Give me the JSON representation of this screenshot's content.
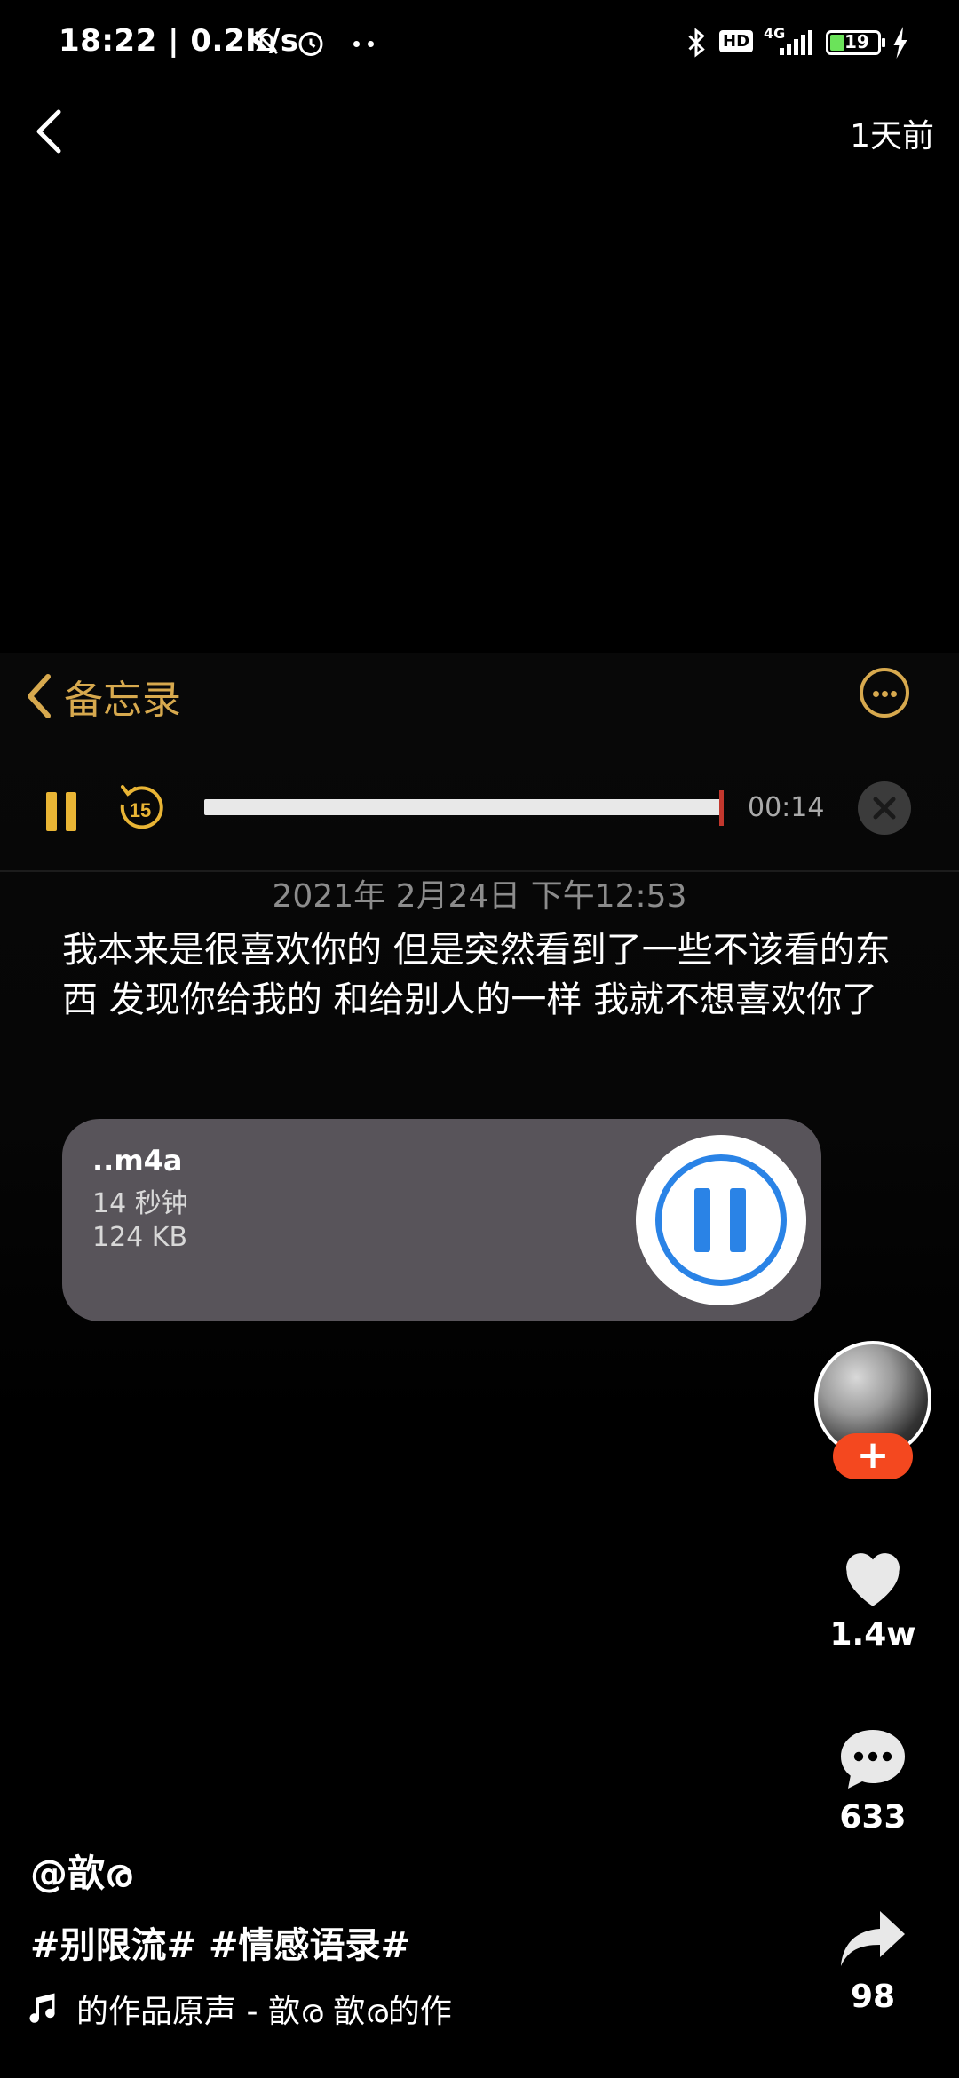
{
  "status_bar": {
    "text": "18:22 | 0.2K/s",
    "network": "4G",
    "hd": "HD",
    "battery": "19"
  },
  "top_bar": {
    "time_ago": "1天前"
  },
  "notes": {
    "back_label": "备忘录",
    "player_time": "00:14",
    "player_progress": 1.0,
    "rewind_seconds": "15",
    "date": "2021年 2月24日 下午12:53",
    "text": "我本来是很喜欢你的 但是突然看到了一些不该看的东西 发现你给我的 和给别人的一样 我就不想喜欢你了",
    "attachment": {
      "name": "..m4a",
      "duration": "14 秒钟",
      "size": "124 KB"
    }
  },
  "rail": {
    "follow_label": "+",
    "likes": "1.4w",
    "comments": "633",
    "shares": "98"
  },
  "caption": {
    "author": "@歆ര",
    "tags": "#别限流# #情感语录#",
    "music": "的作品原声 - 歆ര      歆ര的作"
  },
  "colors": {
    "accent_gold": "#d7a94e",
    "player_blue": "#2a83e6",
    "follow_red": "#f4481f"
  }
}
